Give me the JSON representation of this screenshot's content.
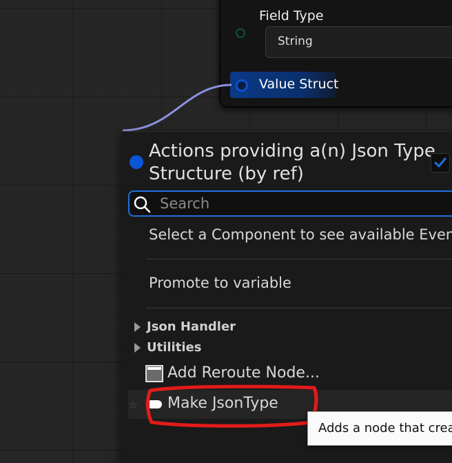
{
  "node": {
    "field_type_label": "Field Type",
    "field_type_value": "String",
    "value_struct_label": "Value Struct"
  },
  "menu": {
    "title": "Actions providing a(n) Json Type Structure (by ref)",
    "context_sensitive_checked": true,
    "search_placeholder": "Search",
    "items": {
      "select_component": "Select a Component to see available Event",
      "promote": "Promote to variable",
      "category_json_handler": "Json Handler",
      "category_utilities": "Utilities",
      "add_reroute": "Add Reroute Node...",
      "make_json_type": "Make JsonType"
    }
  },
  "tooltip": {
    "text": "Adds a node that crea"
  },
  "icons": {
    "search": "search-icon",
    "checkbox": "checkmark-icon",
    "star": "star-icon",
    "reroute": "reroute-node-icon",
    "make": "struct-make-icon"
  },
  "colors": {
    "accent": "#1f6fe0",
    "struct_pin": "#0c4fd0",
    "wire": "#8a93e0",
    "annotation": "#e21b1b"
  }
}
